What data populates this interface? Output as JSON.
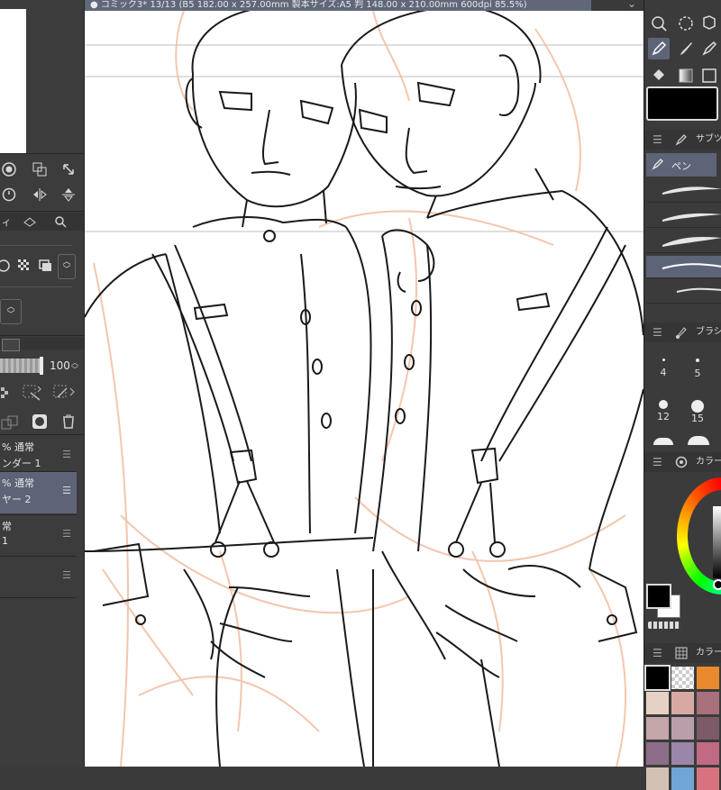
{
  "document": {
    "tab_title": "● コミック3* 13/13 (B5 182.00 x 257.00mm 製本サイズ:A5 判 148.00 x 210.00mm 600dpi 85.5%)"
  },
  "left_panel": {
    "opacity_value": "100",
    "layers": [
      {
        "line1": "% 通常",
        "line2": "ンダー 1",
        "selected": false
      },
      {
        "line1": "% 通常",
        "line2": "ヤー 2",
        "selected": true
      },
      {
        "line1": "常",
        "line2": "1",
        "selected": false
      },
      {
        "line1": "",
        "line2": "",
        "selected": false
      }
    ]
  },
  "right_panel": {
    "sub_tool_header": "サブツ",
    "sub_tool_tab": "ペン",
    "brush_size_header": "ブラシ",
    "brush_sizes": [
      "4",
      "5",
      "12",
      "15"
    ],
    "color_wheel_header": "カラー",
    "color_set_header": "カラー",
    "current_color": "#000000"
  },
  "colors": {
    "selection": "#5d6478",
    "tab": "#5f6778",
    "sketch": "#f0b99a",
    "swatches": [
      "#000000",
      "transparent",
      "#e9892f",
      "#e7d0c4",
      "#d8a9a3",
      "#a8707c",
      "#c4a5aa",
      "#b99faa",
      "#7c5a67",
      "#8c6d8a",
      "#9a86a6",
      "#c16a84",
      "#d2c2b6",
      "#6fa6d6",
      "#d7737f"
    ]
  }
}
